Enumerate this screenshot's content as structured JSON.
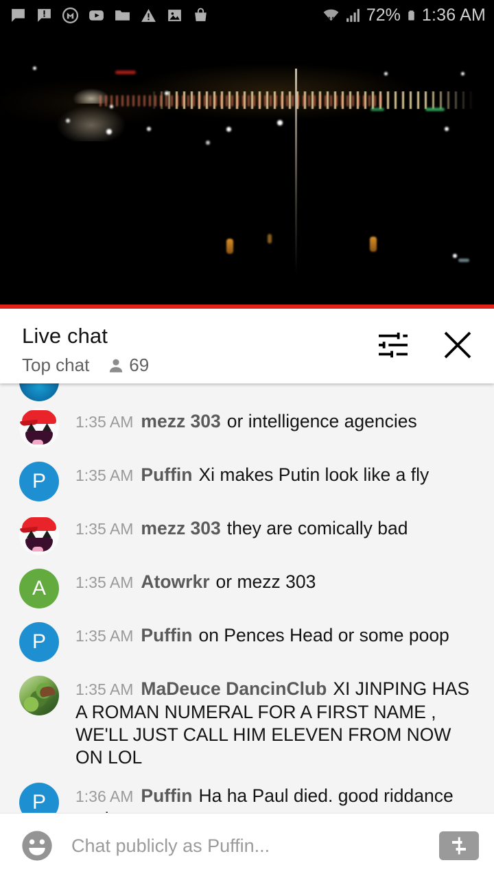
{
  "status_bar": {
    "left_icons": [
      "chat-bubble-icon",
      "chat-alert-icon",
      "m-circle-icon",
      "youtube-play-icon",
      "folder-icon",
      "warning-triangle-icon",
      "image-icon",
      "shopping-bag-icon"
    ],
    "wifi_icon": "wifi-transfer-icon",
    "signal_icon": "cellular-signal-icon",
    "battery_percent": "72%",
    "battery_icon": "battery-icon",
    "time": "1:36 AM"
  },
  "video": {
    "description": "night cityscape with Jefferson Memorial",
    "progress_color": "#e62117"
  },
  "chat_header": {
    "title": "Live chat",
    "mode": "Top chat",
    "viewer_icon": "person-icon",
    "viewer_count": "69",
    "settings_icon": "tune-sliders-icon",
    "close_icon": "close-x-icon"
  },
  "messages": [
    {
      "time": "1:35 AM",
      "author": "mezz 303",
      "text": "or intelligence agencies",
      "avatar_type": "awesome",
      "avatar_letter": ""
    },
    {
      "time": "1:35 AM",
      "author": "Puffin",
      "text": "Xi makes Putin look like a fly",
      "avatar_type": "blue",
      "avatar_letter": "P"
    },
    {
      "time": "1:35 AM",
      "author": "mezz 303",
      "text": "they are comically bad",
      "avatar_type": "awesome",
      "avatar_letter": ""
    },
    {
      "time": "1:35 AM",
      "author": "Atowrkr",
      "text": "or mezz 303",
      "avatar_type": "green",
      "avatar_letter": "A"
    },
    {
      "time": "1:35 AM",
      "author": "Puffin",
      "text": "on Pences Head or some poop",
      "avatar_type": "blue",
      "avatar_letter": "P"
    },
    {
      "time": "1:35 AM",
      "author": "MaDeuce DancinClub",
      "text": "XI JINPING HAS A ROMAN NUMERAL FOR A FIRST NAME , WE'LL JUST CALL HIM ELEVEN FROM NOW ON LOL",
      "avatar_type": "dragon",
      "avatar_letter": ""
    },
    {
      "time": "1:36 AM",
      "author": "Puffin",
      "text": "Ha ha Paul died. good riddance nazi scum",
      "avatar_type": "blue",
      "avatar_letter": "P"
    }
  ],
  "input_bar": {
    "emoji_icon": "emoji-smiley-icon",
    "placeholder": "Chat publicly as Puffin...",
    "value": "",
    "superchat_icon": "super-chat-dollar-icon"
  }
}
